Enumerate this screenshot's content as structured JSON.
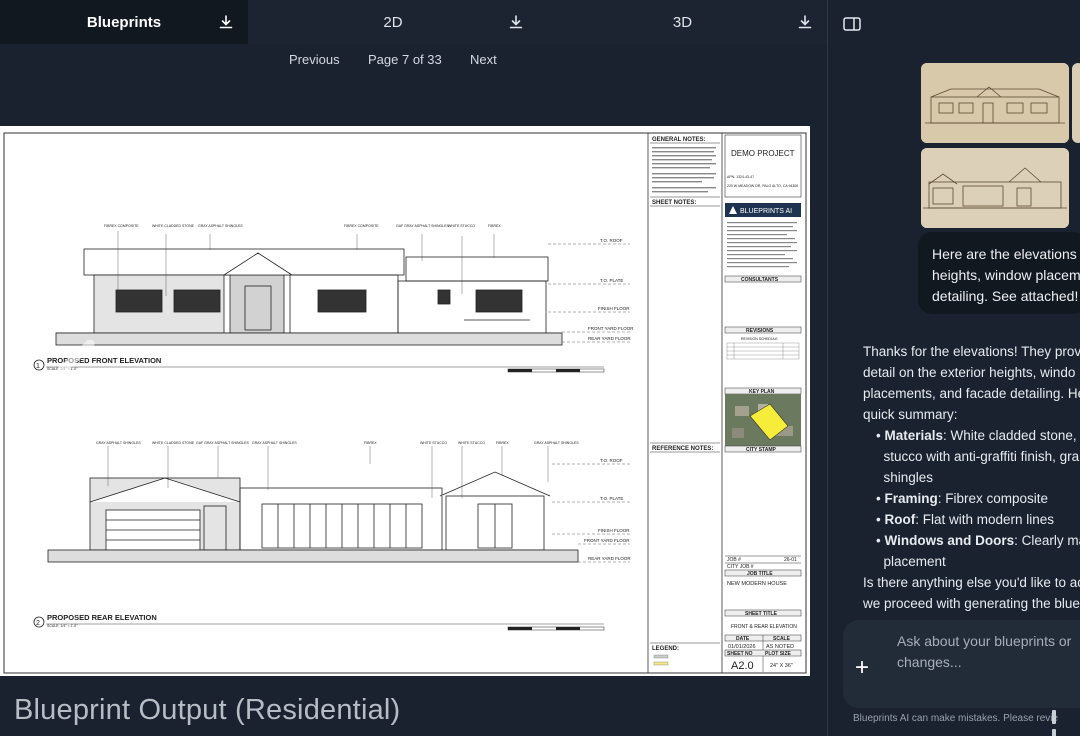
{
  "tabs": [
    {
      "label": "Blueprints",
      "active": true,
      "icon": "download-icon"
    },
    {
      "label": "2D",
      "active": false,
      "icon": "download-icon"
    },
    {
      "label": "3D",
      "active": false,
      "icon": "download-icon"
    }
  ],
  "pager": {
    "previous": "Previous",
    "page": "Page 7 of 33",
    "next": "Next"
  },
  "sheet": {
    "elevation1_title": "PROPOSED FRONT ELEVATION",
    "elevation1_num": "1",
    "elevation2_title": "PROPOSED REAR ELEVATION",
    "elevation2_num": "2",
    "scale_note": "SCALE: 1/4\" = 1'-0\"",
    "general_notes": "GENERAL NOTES:",
    "sheet_notes": "SHEET NOTES:",
    "reference_notes": "REFERENCE NOTES:",
    "legend": "LEGEND:",
    "project": "DEMO PROJECT",
    "apn": "APN: 1324-43-47",
    "address": "220 W MEADOW DR, PALO ALTO, CA 94306",
    "brand": "BLUEPRINTS AI",
    "consultants": "CONSULTANTS",
    "revisions": "REVISIONS",
    "revision_schedule": "REVISION SCHEDULE",
    "key_plan": "KEY PLAN",
    "city_stamp": "CITY STAMP",
    "job_no_label": "JOB #",
    "job_no": "26-01",
    "city_job_label": "CITY JOB #",
    "job_title_label": "JOB TITLE",
    "job_title": "NEW MODERN HOUSE",
    "sheet_title_label": "SHEET TITLE",
    "sheet_title": "FRONT & REAR ELEVATION",
    "date_label": "DATE",
    "date": "01/01/2026",
    "scale_label": "SCALE",
    "scale": "AS NOTED",
    "sheet_no_label": "SHEET NO",
    "sheet_no": "A2.0",
    "plot_size_label": "PLOT SIZE",
    "plot_size": "24\" X 36\"",
    "levels": [
      "T.O. ROOF",
      "T.O. PLATE",
      "FINISH FLOOR",
      "FRONT YARD FLOOR",
      "REAR YARD FLOOR"
    ]
  },
  "caption": "Blueprint Output (Residential)",
  "chat": {
    "user_message_lines": [
      "Here are the elevations t",
      "heights, window placeme",
      "detailing. See attached!"
    ],
    "assistant_intro_lines": [
      "Thanks for the elevations! They prov",
      "detail on the exterior heights, windo",
      "placements, and facade detailing. He",
      "quick summary:"
    ],
    "bullets": [
      {
        "label": "Materials",
        "text": ": White cladded stone,"
      },
      {
        "label": "",
        "text": "stucco with anti-graffiti finish, gra"
      },
      {
        "label": "",
        "text": "shingles"
      },
      {
        "label": "Framing",
        "text": ": Fibrex composite"
      },
      {
        "label": "Roof",
        "text": ": Flat with modern lines"
      },
      {
        "label": "Windows and Doors",
        "text": ": Clearly ma"
      },
      {
        "label": "",
        "text": "placement"
      }
    ],
    "assistant_outro_lines": [
      "Is there anything else you'd like to ac",
      "we proceed with generating the blue"
    ],
    "composer_placeholder_lines": [
      "Ask about your blueprints or",
      "changes..."
    ],
    "disclaimer": "Blueprints AI can make mistakes. Please revie"
  }
}
